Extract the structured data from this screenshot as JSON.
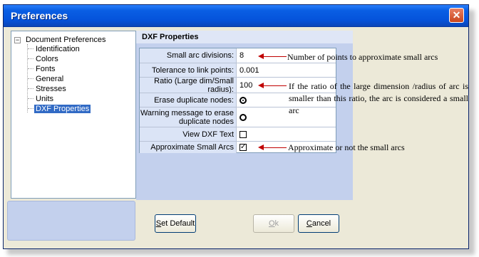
{
  "window": {
    "title": "Preferences"
  },
  "tree": {
    "root": "Document Preferences",
    "items": [
      "Identification",
      "Colors",
      "Fonts",
      "General",
      "Stresses",
      "Units",
      "DXF Properties"
    ]
  },
  "panel": {
    "title": "DXF Properties",
    "rows": [
      {
        "label": "Small arc divisions:",
        "value": "8"
      },
      {
        "label": "Tolerance to link points:",
        "value": "0.001"
      },
      {
        "label": "Ratio (Large dim/Small radius):",
        "value": "100"
      },
      {
        "label": "Erase duplicate nodes:",
        "radio_selected": true
      },
      {
        "label": "Warning message to erase duplicate nodes",
        "radio_selected": false
      },
      {
        "label": "View DXF Text",
        "checked": false
      },
      {
        "label": "Approximate Small Arcs",
        "checked": true
      }
    ]
  },
  "annotations": {
    "small_arcs": "Number of points to approximate small arcs",
    "ratio": "If the ratio of the large dimension /radius of arc is smaller than this ratio, the arc is considered a small arc",
    "approximate": "Approximate or not the small arcs"
  },
  "buttons": {
    "set_default_prefix": "",
    "set_default_u": "S",
    "set_default_rest": "et Default",
    "ok_u": "O",
    "ok_rest": "k",
    "cancel_u": "C",
    "cancel_rest": "ancel"
  },
  "colors": {
    "titlebar": "#0553db",
    "panel": "#c3d0ed",
    "arrow": "#c00000",
    "selection": "#316ac5"
  }
}
